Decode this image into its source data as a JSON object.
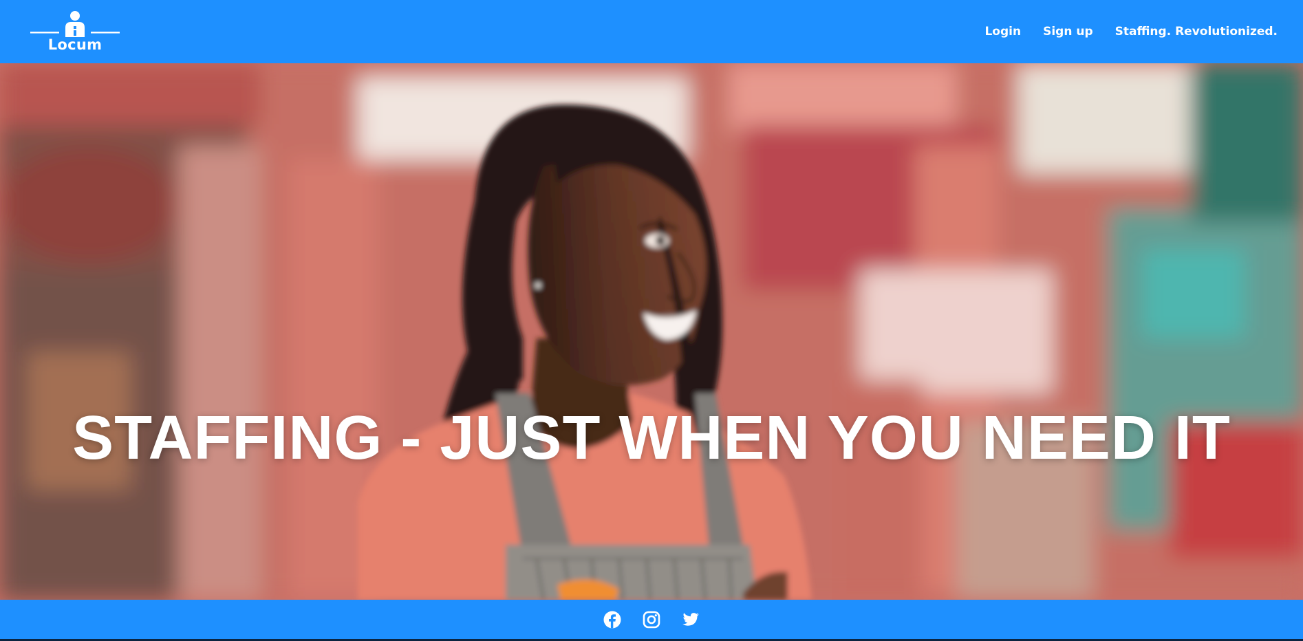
{
  "brand": {
    "name": "Locum"
  },
  "nav": {
    "links": [
      {
        "label": "Login"
      },
      {
        "label": "Sign up"
      },
      {
        "label": "Staffing. Revolutionized."
      }
    ]
  },
  "hero": {
    "heading": "STAFFING - JUST WHEN YOU NEED IT",
    "image": "smiling-woman-in-apron-photo"
  },
  "footer": {
    "social": [
      {
        "icon": "facebook-icon"
      },
      {
        "icon": "instagram-icon"
      },
      {
        "icon": "twitter-icon"
      }
    ]
  },
  "colors": {
    "primary": "#1e90ff",
    "heading_text": "#ffffff",
    "page_bottom": "#0b2440"
  }
}
